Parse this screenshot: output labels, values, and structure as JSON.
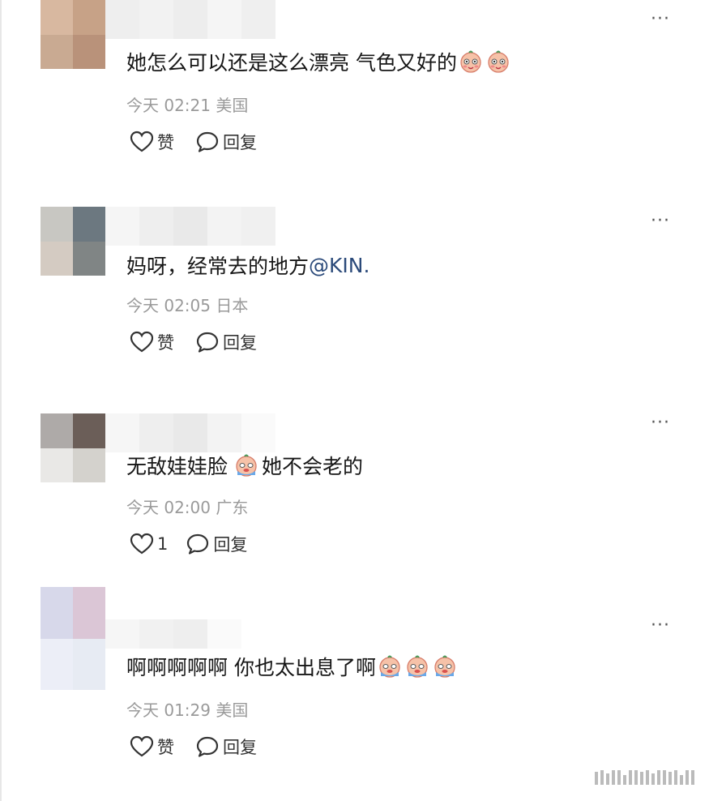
{
  "comments": [
    {
      "avatar_colors": [
        "#d8b8a0",
        "#c7a287",
        "#c9aa92",
        "#b9927a"
      ],
      "name_colors": [
        "#eeeeee",
        "#f2f2f2",
        "#ededed",
        "#f5f5f5",
        "#efefef"
      ],
      "text": "她怎么可以还是这么漂亮 气色又好的",
      "emoji": [
        "blushing-face-icon",
        "blushing-face-icon"
      ],
      "time": "今天 02:21",
      "location": "美国",
      "like_label": "赞",
      "reply_label": "回复"
    },
    {
      "avatar_colors": [
        "#c8c7c2",
        "#6c7880",
        "#d4cbc2",
        "#808585"
      ],
      "name_colors": [
        "#f5f5f5",
        "#eeeeee",
        "#e9e9e9",
        "#f3f3f3",
        "#f0f0f0"
      ],
      "text": "妈呀，经常去的地方",
      "mention": "@KIN.",
      "time": "今天 02:05",
      "location": "日本",
      "like_label": "赞",
      "reply_label": "回复"
    },
    {
      "avatar_colors": [
        "#aeaaa8",
        "#6b5e58",
        "#e9e8e6",
        "#d4d2cd"
      ],
      "name_colors": [
        "#f6f6f6",
        "#eeeeee",
        "#e9e9e9",
        "#f3f3f3",
        "#fafafa"
      ],
      "text_before": "无敌娃娃脸",
      "text_after": "她不会老的",
      "emoji": [
        "crying-face-icon"
      ],
      "time": "今天 02:00",
      "location": "广东",
      "like_label": "1",
      "reply_label": "回复"
    },
    {
      "avatar_colors": [
        "#d7d8ea",
        "#dbc6d6",
        "#eceef7",
        "#e7ebf3"
      ],
      "name_colors": [
        "#f6f6f6",
        "#f1f1f1",
        "#eeeeee",
        "#fafafa"
      ],
      "text": "啊啊啊啊啊 你也太出息了啊",
      "emoji": [
        "crying-face-icon",
        "crying-face-icon",
        "crying-face-icon"
      ],
      "time": "今天 01:29",
      "location": "美国",
      "like_label": "赞",
      "reply_label": "回复"
    }
  ],
  "more_label": "···"
}
